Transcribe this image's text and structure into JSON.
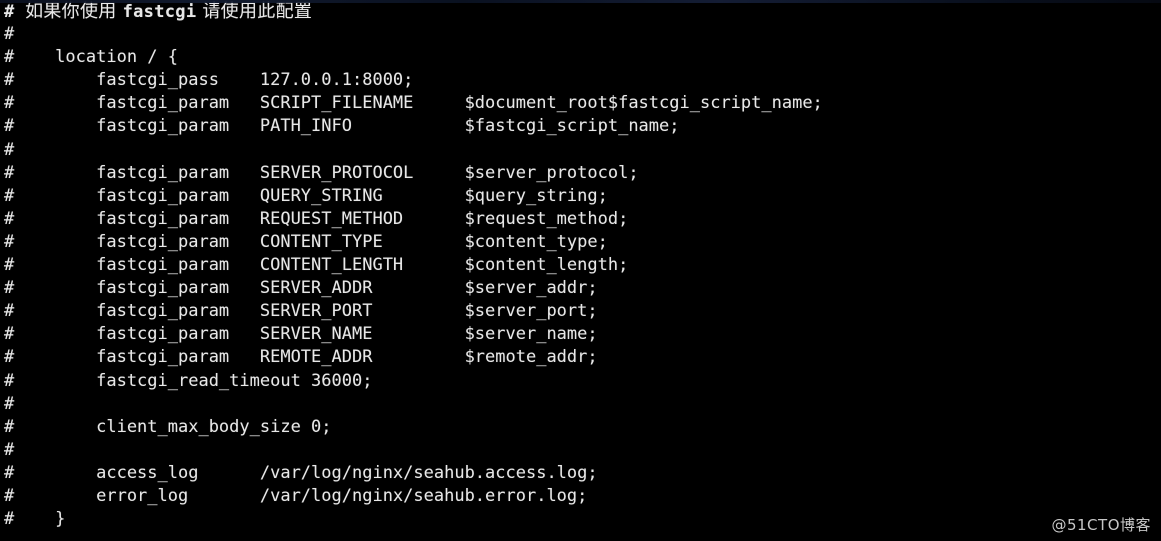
{
  "window": {
    "background_color": "#000000",
    "text_color": "#e8e8e8",
    "top_edge_color": "#131d33"
  },
  "document": {
    "title": "nginx fastcgi configuration (commented block)",
    "comment_char": "#",
    "lines": [
      {
        "id": "l1",
        "type": "cjk",
        "prefix": "# ",
        "pre": "如果你使用 ",
        "mono": "fastcgi",
        "post": " 请使用此配置"
      },
      {
        "id": "l2",
        "type": "mono",
        "text": "#"
      },
      {
        "id": "l3",
        "type": "mono",
        "text": "#    location / {"
      },
      {
        "id": "l4",
        "type": "mono",
        "text": "#        fastcgi_pass    127.0.0.1:8000;"
      },
      {
        "id": "l5",
        "type": "mono",
        "text": "#        fastcgi_param   SCRIPT_FILENAME     $document_root$fastcgi_script_name;"
      },
      {
        "id": "l6",
        "type": "mono",
        "text": "#        fastcgi_param   PATH_INFO           $fastcgi_script_name;"
      },
      {
        "id": "l7",
        "type": "mono",
        "text": "#"
      },
      {
        "id": "l8",
        "type": "mono",
        "text": "#        fastcgi_param   SERVER_PROTOCOL     $server_protocol;"
      },
      {
        "id": "l9",
        "type": "mono",
        "text": "#        fastcgi_param   QUERY_STRING        $query_string;"
      },
      {
        "id": "l10",
        "type": "mono",
        "text": "#        fastcgi_param   REQUEST_METHOD      $request_method;"
      },
      {
        "id": "l11",
        "type": "mono",
        "text": "#        fastcgi_param   CONTENT_TYPE        $content_type;"
      },
      {
        "id": "l12",
        "type": "mono",
        "text": "#        fastcgi_param   CONTENT_LENGTH      $content_length;"
      },
      {
        "id": "l13",
        "type": "mono",
        "text": "#        fastcgi_param   SERVER_ADDR         $server_addr;"
      },
      {
        "id": "l14",
        "type": "mono",
        "text": "#        fastcgi_param   SERVER_PORT         $server_port;"
      },
      {
        "id": "l15",
        "type": "mono",
        "text": "#        fastcgi_param   SERVER_NAME         $server_name;"
      },
      {
        "id": "l16",
        "type": "mono",
        "text": "#        fastcgi_param   REMOTE_ADDR         $remote_addr;"
      },
      {
        "id": "l17",
        "type": "mono",
        "text": "#        fastcgi_read_timeout 36000;"
      },
      {
        "id": "l18",
        "type": "mono",
        "text": "#"
      },
      {
        "id": "l19",
        "type": "mono",
        "text": "#        client_max_body_size 0;"
      },
      {
        "id": "l20",
        "type": "mono",
        "text": "#"
      },
      {
        "id": "l21",
        "type": "mono",
        "text": "#        access_log      /var/log/nginx/seahub.access.log;"
      },
      {
        "id": "l22",
        "type": "mono",
        "text": "#        error_log       /var/log/nginx/seahub.error.log;"
      },
      {
        "id": "l23",
        "type": "mono",
        "text": "#    }"
      }
    ]
  },
  "watermark": {
    "text": "@51CTO博客"
  }
}
